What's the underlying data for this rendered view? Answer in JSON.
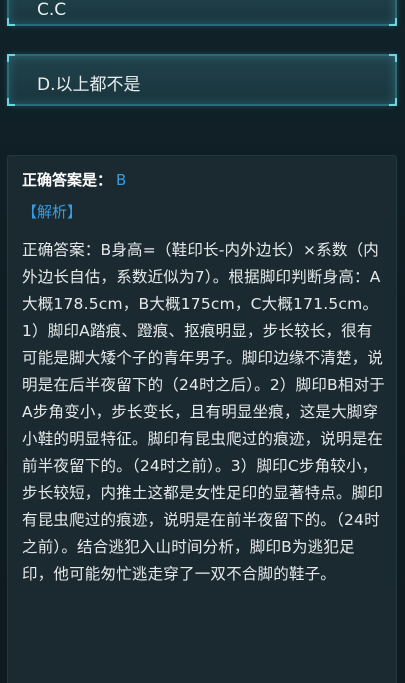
{
  "options": {
    "c_label": "C.C",
    "d_label": "D.以上都不是"
  },
  "answer": {
    "prefix": "正确答案是：",
    "value": "B"
  },
  "analysis": {
    "tag": "【解析】",
    "text": "正确答案：B身高=（鞋印长-内外边长）×系数（内外边长自估，系数近似为7）。根据脚印判断身高：A大概178.5cm，B大概175cm，C大概171.5cm。1）脚印A踏痕、蹬痕、抠痕明显，步长较长，很有可能是脚大矮个子的青年男子。脚印边缘不清楚，说明是在后半夜留下的（24时之后）。2）脚印B相对于A步角变小，步长变长，且有明显坐痕，这是大脚穿小鞋的明显特征。脚印有昆虫爬过的痕迹，说明是在前半夜留下的。（24时之前）。3）脚印C步角较小，步长较短，内推土这都是女性足印的显著特点。脚印有昆虫爬过的痕迹，说明是在前半夜留下的。（24时之前）。结合逃犯入山时间分析，脚印B为逃犯足印，他可能匆忙逃走穿了一双不合脚的鞋子。"
  }
}
